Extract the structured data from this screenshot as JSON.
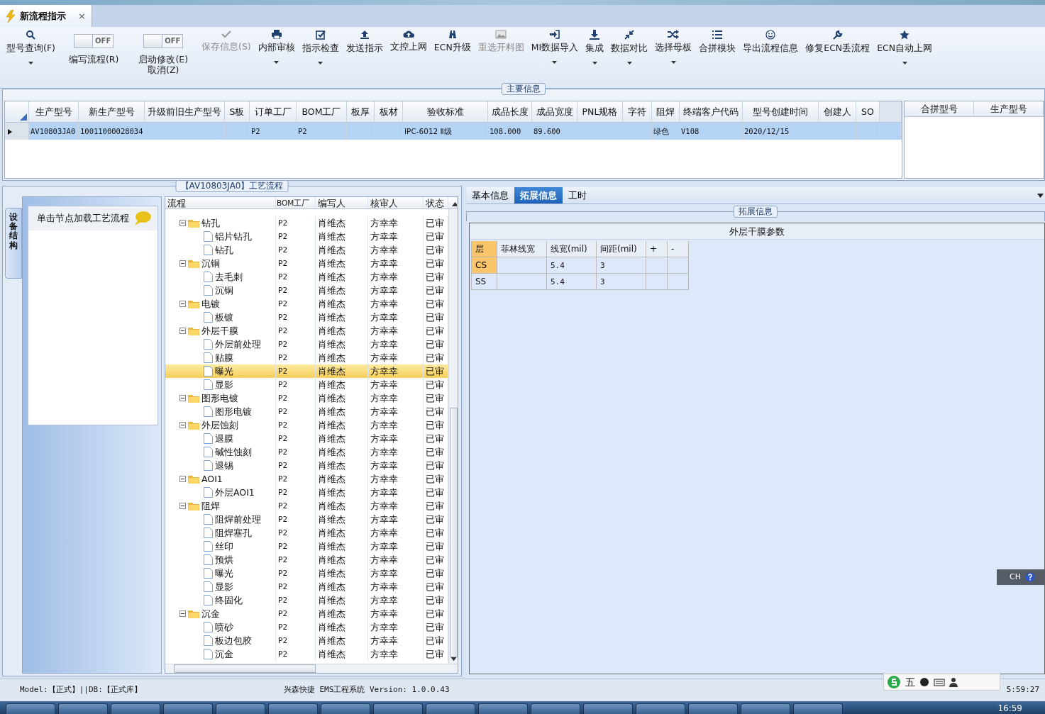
{
  "doc_tab": {
    "title": "新流程指示",
    "close": "×"
  },
  "toolbar": [
    {
      "kind": "button",
      "label": "型号查询(F)",
      "dropdown": true,
      "disabled": false
    },
    {
      "kind": "toggle",
      "label": "编写流程(R)",
      "toggle": "OFF",
      "on": false
    },
    {
      "kind": "toggle",
      "label": "启动修改(E)\n取消(Z)",
      "toggle": "OFF",
      "on": false
    },
    {
      "kind": "button",
      "label": "保存信息(S)",
      "dropdown": false,
      "disabled": true
    },
    {
      "kind": "button",
      "label": "内部审核",
      "dropdown": true,
      "disabled": false
    },
    {
      "kind": "button",
      "label": "指示检查",
      "dropdown": true,
      "disabled": false
    },
    {
      "kind": "button",
      "label": "发送指示",
      "dropdown": false,
      "disabled": false
    },
    {
      "kind": "button",
      "label": "文控上网",
      "dropdown": false,
      "disabled": false
    },
    {
      "kind": "button",
      "label": "ECN升级",
      "dropdown": false,
      "disabled": false
    },
    {
      "kind": "button",
      "label": "重选开料图",
      "dropdown": false,
      "disabled": true
    },
    {
      "kind": "button",
      "label": "MI数据导入",
      "dropdown": true,
      "disabled": false
    },
    {
      "kind": "button",
      "label": "集成",
      "dropdown": true,
      "disabled": false
    },
    {
      "kind": "button",
      "label": "数据对比",
      "dropdown": true,
      "disabled": false
    },
    {
      "kind": "button",
      "label": "选择母板",
      "dropdown": true,
      "disabled": false
    },
    {
      "kind": "button",
      "label": "合拼模块",
      "dropdown": false,
      "disabled": false
    },
    {
      "kind": "button",
      "label": "导出流程信息",
      "dropdown": false,
      "disabled": false
    },
    {
      "kind": "button",
      "label": "修复ECN丢流程",
      "dropdown": false,
      "disabled": false
    },
    {
      "kind": "button",
      "label": "ECN自动上网",
      "dropdown": true,
      "disabled": false
    }
  ],
  "main_info": {
    "legend": "主要信息",
    "columns": [
      "生产型号",
      "新生产型号",
      "升级前旧生产型号",
      "S板",
      "订单工厂",
      "BOM工厂",
      "板厚",
      "板材",
      "验收标准",
      "成品长度",
      "成品宽度",
      "PNL规格",
      "字符",
      "阻焊",
      "终端客户代码",
      "型号创建时间",
      "创建人",
      "SO"
    ],
    "rows": [
      {
        "selected": true,
        "cells": [
          "AV10803JA0",
          "10011000028034",
          null,
          null,
          "P2",
          "P2",
          null,
          null,
          "IPC-6012 Ⅱ级",
          "108.000",
          "89.600",
          null,
          null,
          "绿色",
          "V108",
          "2020/12/15",
          null,
          null
        ]
      }
    ],
    "side_columns": [
      "合拼型号",
      "生产型号"
    ]
  },
  "process": {
    "legend": "【AV10803JA0】工艺流程",
    "side_tab": "设备结构",
    "hint": "单击节点加载工艺流程",
    "columns": [
      "流程",
      "BOM工厂",
      "编写人",
      "核审人",
      "状态"
    ],
    "tree": [
      {
        "name": "钻孔",
        "bom": "P2",
        "writer": "肖维杰",
        "reviewer": "方幸幸",
        "status": "已审",
        "expanded": true,
        "selected": false,
        "children": [
          {
            "name": "铝片钻孔",
            "bom": "P2",
            "writer": "肖维杰",
            "reviewer": "方幸幸",
            "status": "已审",
            "selected": false
          },
          {
            "name": "钻孔",
            "bom": "P2",
            "writer": "肖维杰",
            "reviewer": "方幸幸",
            "status": "已审",
            "selected": false
          }
        ]
      },
      {
        "name": "沉铜",
        "bom": "P2",
        "writer": "肖维杰",
        "reviewer": "方幸幸",
        "status": "已审",
        "expanded": true,
        "selected": false,
        "children": [
          {
            "name": "去毛刺",
            "bom": "P2",
            "writer": "肖维杰",
            "reviewer": "方幸幸",
            "status": "已审",
            "selected": false
          },
          {
            "name": "沉铜",
            "bom": "P2",
            "writer": "肖维杰",
            "reviewer": "方幸幸",
            "status": "已审",
            "selected": false
          }
        ]
      },
      {
        "name": "电镀",
        "bom": "P2",
        "writer": "肖维杰",
        "reviewer": "方幸幸",
        "status": "已审",
        "expanded": true,
        "selected": false,
        "children": [
          {
            "name": "板镀",
            "bom": "P2",
            "writer": "肖维杰",
            "reviewer": "方幸幸",
            "status": "已审",
            "selected": false
          }
        ]
      },
      {
        "name": "外层干膜",
        "bom": "P2",
        "writer": "肖维杰",
        "reviewer": "方幸幸",
        "status": "已审",
        "expanded": true,
        "selected": false,
        "children": [
          {
            "name": "外层前处理",
            "bom": "P2",
            "writer": "肖维杰",
            "reviewer": "方幸幸",
            "status": "已审",
            "selected": false
          },
          {
            "name": "贴膜",
            "bom": "P2",
            "writer": "肖维杰",
            "reviewer": "方幸幸",
            "status": "已审",
            "selected": false
          },
          {
            "name": "曝光",
            "bom": "P2",
            "writer": "肖维杰",
            "reviewer": "方幸幸",
            "status": "已审",
            "selected": true
          },
          {
            "name": "显影",
            "bom": "P2",
            "writer": "肖维杰",
            "reviewer": "方幸幸",
            "status": "已审",
            "selected": false
          }
        ]
      },
      {
        "name": "图形电镀",
        "bom": "P2",
        "writer": "肖维杰",
        "reviewer": "方幸幸",
        "status": "已审",
        "expanded": true,
        "selected": false,
        "children": [
          {
            "name": "图形电镀",
            "bom": "P2",
            "writer": "肖维杰",
            "reviewer": "方幸幸",
            "status": "已审",
            "selected": false
          }
        ]
      },
      {
        "name": "外层蚀刻",
        "bom": "P2",
        "writer": "肖维杰",
        "reviewer": "方幸幸",
        "status": "已审",
        "expanded": true,
        "selected": false,
        "children": [
          {
            "name": "退膜",
            "bom": "P2",
            "writer": "肖维杰",
            "reviewer": "方幸幸",
            "status": "已审",
            "selected": false
          },
          {
            "name": "碱性蚀刻",
            "bom": "P2",
            "writer": "肖维杰",
            "reviewer": "方幸幸",
            "status": "已审",
            "selected": false
          },
          {
            "name": "退锡",
            "bom": "P2",
            "writer": "肖维杰",
            "reviewer": "方幸幸",
            "status": "已审",
            "selected": false
          }
        ]
      },
      {
        "name": "AOI1",
        "bom": "P2",
        "writer": "肖维杰",
        "reviewer": "方幸幸",
        "status": "已审",
        "expanded": true,
        "selected": false,
        "children": [
          {
            "name": "外层AOI1",
            "bom": "P2",
            "writer": "肖维杰",
            "reviewer": "方幸幸",
            "status": "已审",
            "selected": false
          }
        ]
      },
      {
        "name": "阻焊",
        "bom": "P2",
        "writer": "肖维杰",
        "reviewer": "方幸幸",
        "status": "已审",
        "expanded": true,
        "selected": false,
        "children": [
          {
            "name": "阻焊前处理",
            "bom": "P2",
            "writer": "肖维杰",
            "reviewer": "方幸幸",
            "status": "已审",
            "selected": false
          },
          {
            "name": "阻焊塞孔",
            "bom": "P2",
            "writer": "肖维杰",
            "reviewer": "方幸幸",
            "status": "已审",
            "selected": false
          },
          {
            "name": "丝印",
            "bom": "P2",
            "writer": "肖维杰",
            "reviewer": "方幸幸",
            "status": "已审",
            "selected": false
          },
          {
            "name": "预烘",
            "bom": "P2",
            "writer": "肖维杰",
            "reviewer": "方幸幸",
            "status": "已审",
            "selected": false
          },
          {
            "name": "曝光",
            "bom": "P2",
            "writer": "肖维杰",
            "reviewer": "方幸幸",
            "status": "已审",
            "selected": false
          },
          {
            "name": "显影",
            "bom": "P2",
            "writer": "肖维杰",
            "reviewer": "方幸幸",
            "status": "已审",
            "selected": false
          },
          {
            "name": "终固化",
            "bom": "P2",
            "writer": "肖维杰",
            "reviewer": "方幸幸",
            "status": "已审",
            "selected": false
          }
        ]
      },
      {
        "name": "沉金",
        "bom": "P2",
        "writer": "肖维杰",
        "reviewer": "方幸幸",
        "status": "已审",
        "expanded": true,
        "selected": false,
        "children": [
          {
            "name": "喷砂",
            "bom": "P2",
            "writer": "肖维杰",
            "reviewer": "方幸幸",
            "status": "已审",
            "selected": false
          },
          {
            "name": "板边包胶",
            "bom": "P2",
            "writer": "肖维杰",
            "reviewer": "方幸幸",
            "status": "已审",
            "selected": false
          },
          {
            "name": "沉金",
            "bom": "P2",
            "writer": "肖维杰",
            "reviewer": "方幸幸",
            "status": "已审",
            "selected": false
          }
        ]
      }
    ]
  },
  "detail": {
    "tabs": [
      {
        "label": "基本信息",
        "selected": false
      },
      {
        "label": "拓展信息",
        "selected": true
      },
      {
        "label": "工时",
        "selected": false
      }
    ],
    "legend": "拓展信息",
    "grid_title": "外层干膜参数",
    "columns": [
      "层",
      "菲林线宽",
      "线宽(mil)",
      "间距(mil)",
      "+",
      "-"
    ],
    "rows": [
      {
        "selected": true,
        "cells": [
          "CS",
          null,
          "5.4",
          "3",
          null,
          null
        ]
      },
      {
        "selected": false,
        "cells": [
          "SS",
          null,
          "5.4",
          "3",
          null,
          null
        ]
      }
    ]
  },
  "status_bar": {
    "left": "Model:【正式】||DB:【正式库】",
    "center": "兴森快捷 EMS工程系统 Version: 1.0.0.43",
    "right": "5:59:27"
  },
  "ime": {
    "mode": "五",
    "lang": "CH"
  },
  "taskbar": {
    "clock": "16:59"
  }
}
